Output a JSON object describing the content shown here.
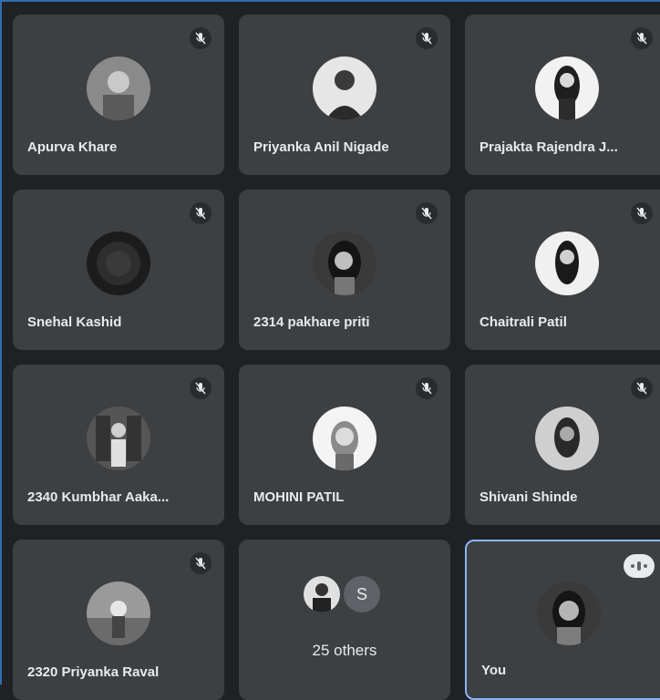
{
  "participants": [
    {
      "name": "Apurva Khare",
      "muted": true
    },
    {
      "name": "Priyanka Anil Nigade",
      "muted": true
    },
    {
      "name": "Prajakta Rajendra J...",
      "muted": true
    },
    {
      "name": "Snehal Kashid",
      "muted": true
    },
    {
      "name": "2314 pakhare priti",
      "muted": true
    },
    {
      "name": "Chaitrali Patil",
      "muted": true
    },
    {
      "name": "2340 Kumbhar Aaka...",
      "muted": true
    },
    {
      "name": "MOHINI PATIL",
      "muted": true
    },
    {
      "name": "Shivani Shinde",
      "muted": true
    },
    {
      "name": "2320 Priyanka Raval",
      "muted": true
    }
  ],
  "others": {
    "initial": "S",
    "label": "25 others"
  },
  "self": {
    "name": "You",
    "speaking": true
  },
  "icons": {
    "muted": "mic-off-icon",
    "speaking": "speaking-indicator-icon"
  }
}
